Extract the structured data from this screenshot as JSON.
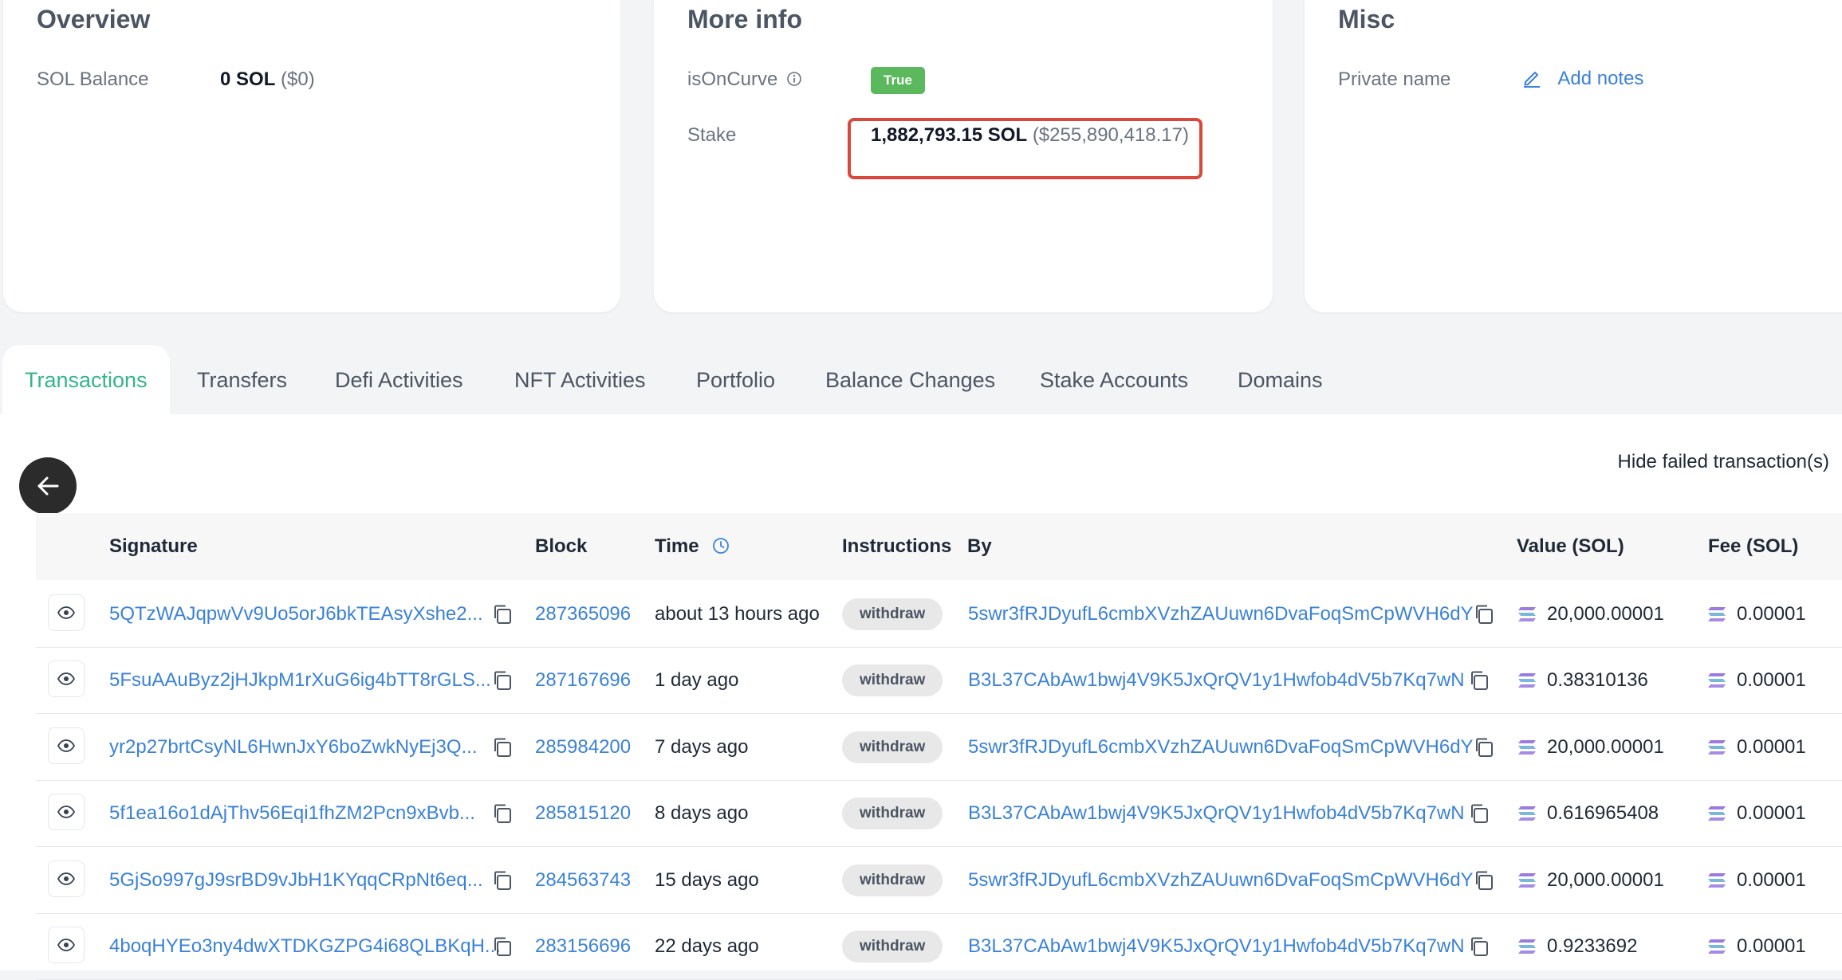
{
  "overview": {
    "title": "Overview",
    "sol_balance_label": "SOL Balance",
    "sol_balance_value": "0 SOL",
    "sol_balance_usd": "($0)"
  },
  "more_info": {
    "title": "More info",
    "is_on_curve_label": "isOnCurve",
    "is_on_curve_badge": "True",
    "stake_label": "Stake",
    "stake_value": "1,882,793.15 SOL",
    "stake_usd": "($255,890,418.17)"
  },
  "misc": {
    "title": "Misc",
    "private_name_label": "Private name",
    "add_notes": "Add notes"
  },
  "tabs": [
    {
      "label": "Transactions"
    },
    {
      "label": "Transfers"
    },
    {
      "label": "Defi Activities"
    },
    {
      "label": "NFT Activities"
    },
    {
      "label": "Portfolio"
    },
    {
      "label": "Balance Changes"
    },
    {
      "label": "Stake Accounts"
    },
    {
      "label": "Domains"
    }
  ],
  "hide_failed": "Hide failed transaction(s)",
  "table": {
    "headers": {
      "signature": "Signature",
      "block": "Block",
      "time": "Time",
      "instructions": "Instructions",
      "by": "By",
      "value": "Value (SOL)",
      "fee": "Fee (SOL)"
    },
    "rows": [
      {
        "signature": "5QTzWAJqpwVv9Uo5orJ6bkTEAsyXshe2...",
        "block": "287365096",
        "time": "about 13 hours ago",
        "instruction": "withdraw",
        "by": "5swr3fRJDyufL6cmbXVzhZAUuwn6DvaFoqSmCpWVH6dY",
        "value": "20,000.00001",
        "fee": "0.00001"
      },
      {
        "signature": "5FsuAAuByz2jHJkpM1rXuG6ig4bTT8rGLS...",
        "block": "287167696",
        "time": "1 day ago",
        "instruction": "withdraw",
        "by": "B3L37CAbAw1bwj4V9K5JxQrQV1y1Hwfob4dV5b7Kq7wN",
        "value": "0.38310136",
        "fee": "0.00001"
      },
      {
        "signature": "yr2p27brtCsyNL6HwnJxY6boZwkNyEj3Q...",
        "block": "285984200",
        "time": "7 days ago",
        "instruction": "withdraw",
        "by": "5swr3fRJDyufL6cmbXVzhZAUuwn6DvaFoqSmCpWVH6dY",
        "value": "20,000.00001",
        "fee": "0.00001"
      },
      {
        "signature": "5f1ea16o1dAjThv56Eqi1fhZM2Pcn9xBvb...",
        "block": "285815120",
        "time": "8 days ago",
        "instruction": "withdraw",
        "by": "B3L37CAbAw1bwj4V9K5JxQrQV1y1Hwfob4dV5b7Kq7wN",
        "value": "0.616965408",
        "fee": "0.00001"
      },
      {
        "signature": "5GjSo997gJ9srBD9vJbH1KYqqCRpNt6eq...",
        "block": "284563743",
        "time": "15 days ago",
        "instruction": "withdraw",
        "by": "5swr3fRJDyufL6cmbXVzhZAUuwn6DvaFoqSmCpWVH6dY",
        "value": "20,000.00001",
        "fee": "0.00001"
      },
      {
        "signature": "4boqHYEo3ny4dwXTDKGZPG4i68QLBKqH...",
        "block": "283156696",
        "time": "22 days ago",
        "instruction": "withdraw",
        "by": "B3L37CAbAw1bwj4V9K5JxQrQV1y1Hwfob4dV5b7Kq7wN",
        "value": "0.9233692",
        "fee": "0.00001"
      }
    ]
  },
  "colors": {
    "accent_green": "#34b58a",
    "link_blue": "#3b82d6",
    "true_badge": "#5cb85c",
    "highlight_red": "#d9483b"
  }
}
